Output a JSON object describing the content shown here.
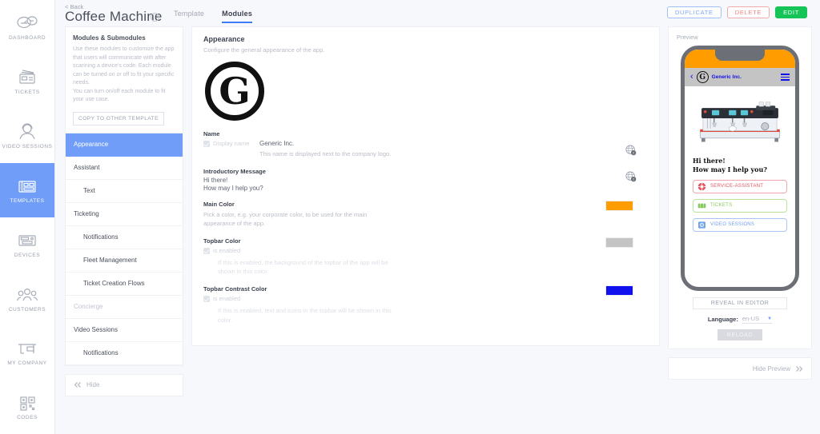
{
  "nav": {
    "items": [
      {
        "label": "DASHBOARD",
        "icon": "dashboard-icon",
        "active": false
      },
      {
        "label": "TICKETS",
        "icon": "tickets-icon",
        "active": false
      },
      {
        "label": "VIDEO SESSIONS",
        "icon": "video-sessions-icon",
        "active": false
      },
      {
        "label": "TEMPLATES",
        "icon": "templates-icon",
        "active": true
      },
      {
        "label": "DEVICES",
        "icon": "devices-icon",
        "active": false
      },
      {
        "label": "CUSTOMERS",
        "icon": "customers-icon",
        "active": false
      },
      {
        "label": "MY COMPANY",
        "icon": "my-company-icon",
        "active": false
      },
      {
        "label": "CODES",
        "icon": "codes-icon",
        "active": false
      }
    ]
  },
  "header": {
    "back_label": "< Back",
    "title": "Coffee Machine",
    "info_icon": "info-icon",
    "tabs": [
      {
        "label": "Template",
        "active": false
      },
      {
        "label": "Modules",
        "active": true
      }
    ],
    "actions": {
      "duplicate": "DUPLICATE",
      "delete": "DELETE",
      "edit": "EDIT"
    }
  },
  "modules_panel": {
    "heading": "Modules & Submodules",
    "description": "Use these modules to customize the app that users will communicate with after scanning a device's code. Each module can be turned on or off to fit your specific needs.\nYou can turn on/off each module to fit your use case.",
    "copy_button": "COPY TO OTHER TEMPLATE",
    "items": [
      {
        "label": "Appearance",
        "level": 0,
        "active": true,
        "dim": false
      },
      {
        "label": "Assistant",
        "level": 0,
        "active": false,
        "dim": false
      },
      {
        "label": "Text",
        "level": 1,
        "active": false,
        "dim": false
      },
      {
        "label": "Ticketing",
        "level": 0,
        "active": false,
        "dim": false
      },
      {
        "label": "Notifications",
        "level": 1,
        "active": false,
        "dim": false
      },
      {
        "label": "Fleet Management",
        "level": 1,
        "active": false,
        "dim": false
      },
      {
        "label": "Ticket Creation Flows",
        "level": 1,
        "active": false,
        "dim": false
      },
      {
        "label": "Concierge",
        "level": 0,
        "active": false,
        "dim": true
      },
      {
        "label": "Video Sessions",
        "level": 0,
        "active": false,
        "dim": false
      },
      {
        "label": "Notifications",
        "level": 1,
        "active": false,
        "dim": false
      }
    ],
    "hide_label": "Hide",
    "hide_icon": "chevron-double-left-icon"
  },
  "appearance": {
    "heading": "Appearance",
    "subheading": "Configure the general appearance of the app.",
    "logo_letter": "G",
    "fields": {
      "name": {
        "label": "Name",
        "checkbox_label": "Display name",
        "checked": true,
        "value": "Generic Inc.",
        "hint": "This name is displayed next to the company logo.",
        "translate_icon": "globe-icon",
        "translate_count": "2"
      },
      "intro": {
        "label": "Introductory Message",
        "line1": "Hi there!",
        "line2": "How may I help you?",
        "translate_icon": "globe-icon",
        "translate_count": "2"
      },
      "main_color": {
        "label": "Main Color",
        "hint": "Pick a color, e.g. your corporate color, to be used for the main appearance of the app.",
        "color": "#FF9D00"
      },
      "topbar_color": {
        "label": "Topbar Color",
        "checkbox_label": "is enabled",
        "checked": true,
        "hint": "If this is enabled, the background of the topbar of the app will be shown in this color.",
        "color": "#C4C4C4"
      },
      "topbar_contrast_color": {
        "label": "Topbar Contrast Color",
        "checkbox_label": "is enabled",
        "checked": true,
        "hint": "If this is enabled, text and icons in the topbar will be shown in this color.",
        "color": "#1111EE"
      }
    }
  },
  "preview": {
    "title": "Preview",
    "phone": {
      "statusbar_color": "#FF9D00",
      "topbar_color": "#C4C4C4",
      "contrast_color": "#1111EE",
      "back_icon": "chevron-left-icon",
      "logo_letter": "G",
      "company_name": "Generic Inc.",
      "menu_icon": "hamburger-icon",
      "device_image": "coffee-machine-image",
      "greeting_line1": "Hi there!",
      "greeting_line2": "How may I help you?",
      "buttons": [
        {
          "label": "SERVICE-ASSISTANT",
          "icon": "lifebuoy-icon",
          "color": "#E8545F"
        },
        {
          "label": "TICKETS",
          "icon": "ticket-icon",
          "color": "#86C95F"
        },
        {
          "label": "VIDEO SESSIONS",
          "icon": "video-camera-icon",
          "color": "#6FA0EA"
        }
      ]
    },
    "reveal_button": "REVEAL IN EDITOR",
    "language_label": "Language:",
    "language_value": "en-US",
    "reload_button": "RELOAD",
    "hide_label": "Hide Preview",
    "hide_icon": "chevron-double-right-icon"
  }
}
